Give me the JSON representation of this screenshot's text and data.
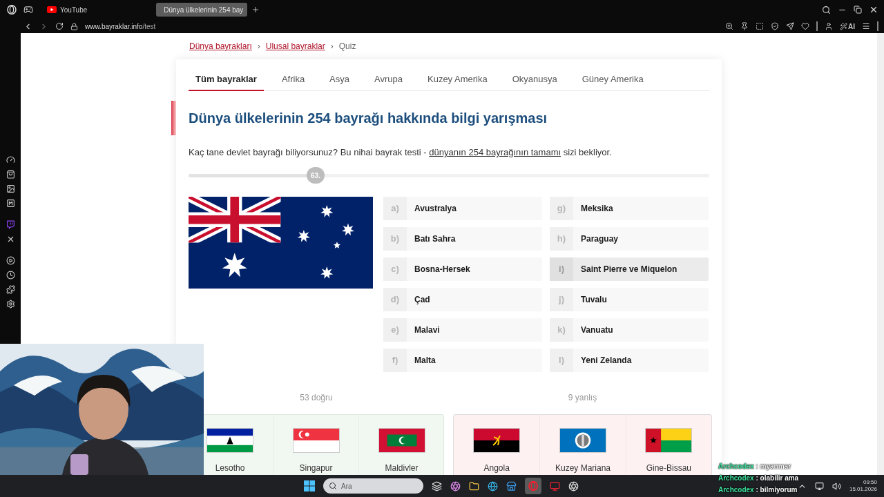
{
  "browser": {
    "tabs": [
      {
        "title": "YouTube",
        "kind": "youtube",
        "selected": false
      },
      {
        "title": "Dünya ülkelerinin 254 bay",
        "kind": "site",
        "selected": true
      }
    ],
    "url_host": "www.bayraklar.info",
    "url_path": "/test",
    "ai_label": "AI"
  },
  "breadcrumb": {
    "separator": "›",
    "items": [
      {
        "label": "Dünya bayrakları",
        "kind": "link"
      },
      {
        "label": "Ulusal bayraklar",
        "kind": "link"
      },
      {
        "label": "Quiz",
        "kind": "current"
      }
    ]
  },
  "quiz_tabs": [
    {
      "label": "Tüm bayraklar",
      "selected": true
    },
    {
      "label": "Afrika",
      "selected": false
    },
    {
      "label": "Asya",
      "selected": false
    },
    {
      "label": "Avrupa",
      "selected": false
    },
    {
      "label": "Kuzey Amerika",
      "selected": false
    },
    {
      "label": "Okyanusya",
      "selected": false
    },
    {
      "label": "Güney Amerika",
      "selected": false
    }
  ],
  "title": "Dünya ülkelerinin 254 bayrağı hakkında bilgi yarışması",
  "intro": {
    "before": "Kaç tane devlet bayrağı biliyorsunuz? Bu nihai bayrak testi - ",
    "link": "dünyanın 254 bayrağının tamamı",
    "after": " sizi bekliyor."
  },
  "progress": {
    "label": "63.",
    "level": 0.244
  },
  "question_flag": {
    "kind": "australia"
  },
  "options": [
    {
      "letter": "a)",
      "label": "Avustralya",
      "hovered": false
    },
    {
      "letter": "b)",
      "label": "Batı Sahra",
      "hovered": false
    },
    {
      "letter": "c)",
      "label": "Bosna-Hersek",
      "hovered": false
    },
    {
      "letter": "d)",
      "label": "Çad",
      "hovered": false
    },
    {
      "letter": "e)",
      "label": "Malavi",
      "hovered": false
    },
    {
      "letter": "f)",
      "label": "Malta",
      "hovered": false
    },
    {
      "letter": "g)",
      "label": "Meksika",
      "hovered": false
    },
    {
      "letter": "h)",
      "label": "Paraguay",
      "hovered": false
    },
    {
      "letter": "i)",
      "label": "Saint Pierre ve Miquelon",
      "hovered": true
    },
    {
      "letter": "j)",
      "label": "Tuvalu",
      "hovered": false
    },
    {
      "letter": "k)",
      "label": "Vanuatu",
      "hovered": false
    },
    {
      "letter": "l)",
      "label": "Yeni Zelanda",
      "hovered": false
    }
  ],
  "results": [
    {
      "kind": "correct",
      "caption": "53 doğru",
      "items": [
        {
          "name": "Lesotho",
          "kind": "lesotho"
        },
        {
          "name": "Singapur",
          "kind": "singapore"
        },
        {
          "name": "Maldivler",
          "kind": "maldives"
        }
      ]
    },
    {
      "kind": "wrong",
      "caption": "9 yanlış",
      "items": [
        {
          "name": "Angola",
          "kind": "angola"
        },
        {
          "name": "Kuzey Mariana",
          "kind": "nmi"
        },
        {
          "name": "Gine-Bissau",
          "kind": "guinea_bissau"
        }
      ]
    }
  ],
  "chat": [
    {
      "user": "Archcodex",
      "message": ": myanmar"
    },
    {
      "user": "Archcodex",
      "message": ": olabilir ama"
    },
    {
      "user": "Archcodex",
      "message": ": bilmiyorum"
    }
  ],
  "taskbar": {
    "search_placeholder": "Ara",
    "time": "09:50",
    "date": "15.01.2026"
  }
}
